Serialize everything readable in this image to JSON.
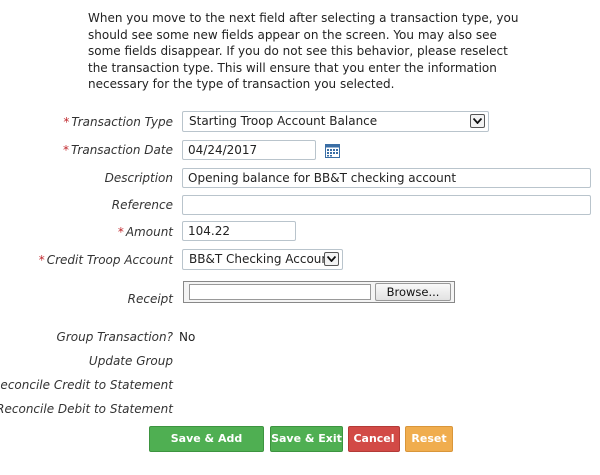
{
  "instructions": "When you move to the next field after selecting a transaction type, you should see some new fields appear on the screen. You may also see some fields disappear. If you do not see this behavior, please reselect the transaction type. This will ensure that you enter the information necessary for the type of transaction you selected.",
  "form": {
    "required_mark": "*",
    "transaction_type": {
      "label": "Transaction Type",
      "value": "Starting Troop Account Balance"
    },
    "transaction_date": {
      "label": "Transaction Date",
      "value": "04/24/2017"
    },
    "description": {
      "label": "Description",
      "value": "Opening balance for BB&T checking account"
    },
    "reference": {
      "label": "Reference",
      "value": ""
    },
    "amount": {
      "label": "Amount",
      "value": "104.22"
    },
    "credit_account": {
      "label": "Credit Troop Account",
      "value": "BB&T Checking Account"
    },
    "receipt": {
      "label": "Receipt",
      "browse_label": "Browse..."
    },
    "group_transaction": {
      "label": "Group Transaction?",
      "value": "No"
    },
    "update_group": {
      "label": "Update Group"
    },
    "reconcile_credit": {
      "label": "Reconcile Credit to Statement"
    },
    "reconcile_debit": {
      "label": "Reconcile Debit to Statement"
    }
  },
  "buttons": {
    "save_add": "Save & Add Another",
    "save_exit": "Save & Exit",
    "cancel": "Cancel",
    "reset": "Reset"
  },
  "colors": {
    "required": "#c0282d",
    "save_green": "#4faf52",
    "cancel_red": "#d24a46",
    "reset_orange": "#f0ad4e"
  },
  "icons": {
    "date_picker": "calendar-icon",
    "select_arrow": "chevron-down-icon"
  }
}
